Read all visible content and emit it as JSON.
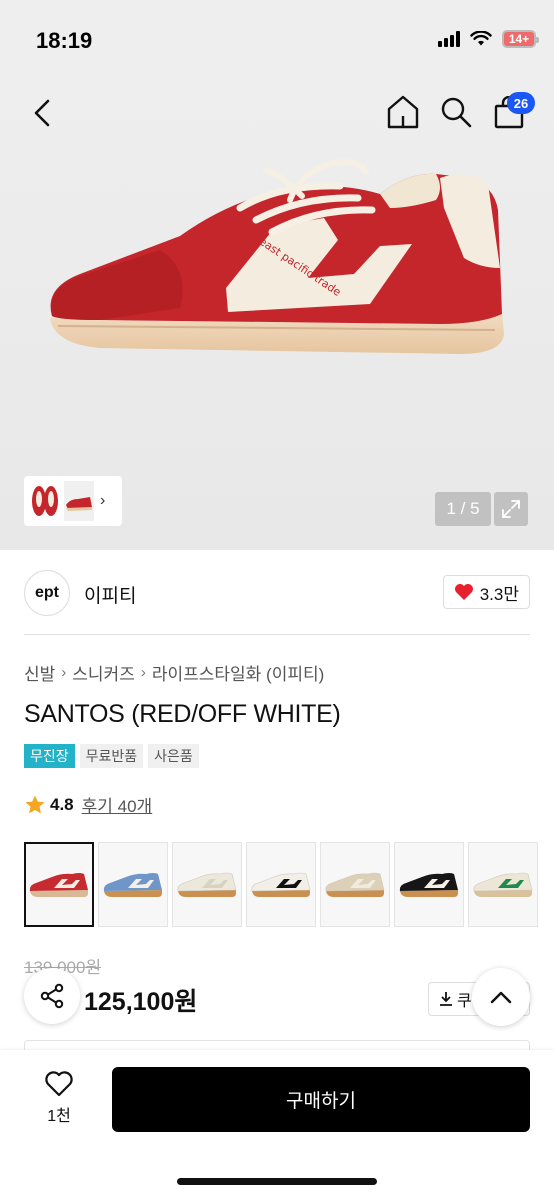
{
  "status_bar": {
    "time": "18:19",
    "battery": "14+"
  },
  "header": {
    "cart_count": "26"
  },
  "gallery": {
    "page_indicator": "1 / 5"
  },
  "brand": {
    "logo_text": "ept",
    "name": "이피티",
    "like_count": "3.3만"
  },
  "breadcrumb": [
    "신발",
    "스니커즈",
    "라이프스타일화 (이피티)"
  ],
  "product": {
    "title": "SANTOS (RED/OFF WHITE)",
    "tags": [
      "무진장",
      "무료반품",
      "사은품"
    ],
    "rating": "4.8",
    "review_label": "후기 40개"
  },
  "color_options": [
    {
      "body": "#c62b30",
      "stripe": "#f4ede0",
      "sole": "#d9b896",
      "selected": true
    },
    {
      "body": "#6f95c9",
      "stripe": "#f4f0e8",
      "sole": "#c9904f",
      "selected": false
    },
    {
      "body": "#ece8dc",
      "stripe": "#d8d2c2",
      "sole": "#c9904f",
      "selected": false
    },
    {
      "body": "#f2efe8",
      "stripe": "#111111",
      "sole": "#c9904f",
      "selected": false
    },
    {
      "body": "#ddd0b8",
      "stripe": "#f1ebdf",
      "sole": "#c9904f",
      "selected": false
    },
    {
      "body": "#161616",
      "stripe": "#f4f0e8",
      "sole": "#c9904f",
      "selected": false
    },
    {
      "body": "#ece6d6",
      "stripe": "#1e8a4c",
      "sole": "#d8c19b",
      "selected": false
    }
  ],
  "price": {
    "original": "139,000원",
    "sale": "125,100원",
    "coupon_label": "쿠"
  },
  "bottom_bar": {
    "wish_count": "1천",
    "buy_label": "구매하기"
  },
  "colors": {
    "accent_blue": "#1a57f5",
    "tag_primary": "#22b3c9",
    "heart_red": "#e8212e",
    "star": "#f5a623"
  }
}
